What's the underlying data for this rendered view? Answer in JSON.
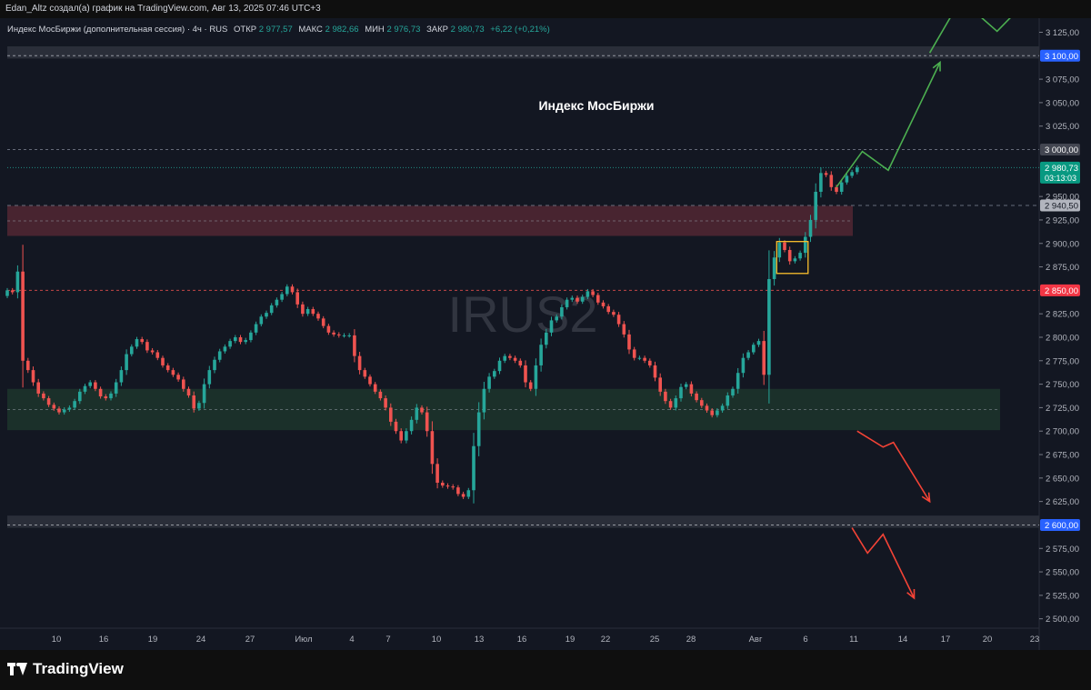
{
  "header": {
    "credit": "Edan_Altz создал(а) график на TradingView.com, Авг 13, 2025 07:46 UTC+3"
  },
  "legend": {
    "symbol": "Индекс МосБиржи (дополнительная сессия) · 4ч · RUS",
    "open_label": "ОТКР",
    "open_value": "2 977,57",
    "high_label": "МАКС",
    "high_value": "2 982,66",
    "low_label": "МИН",
    "low_value": "2 976,73",
    "close_label": "ЗАКР",
    "close_value": "2 980,73",
    "change": "+6,22 (+0,21%)"
  },
  "annotation_title": "Индекс МосБиржи",
  "watermark": "IRUS2",
  "brand": "TradingView",
  "colors": {
    "background": "#131722",
    "up": "#26a69a",
    "down": "#ef5350",
    "resistance_zone": "#5b2a35",
    "support_zone": "#1f3a2e",
    "level_band": "#2a2e39",
    "blue_label": "#2962ff",
    "red_label": "#f23645",
    "teal_label": "#089981",
    "arrow_up": "#4caf50",
    "arrow_down": "#f44336",
    "highlight_box": "#fbc02d"
  },
  "chart_data": {
    "type": "candlestick",
    "timeframe": "4ч",
    "y_range": [
      2490,
      3140
    ],
    "y_ticks": [
      "3 125,00",
      "3 075,00",
      "3 050,00",
      "3 025,00",
      "2 950,00",
      "2 925,00",
      "2 900,00",
      "2 875,00",
      "2 825,00",
      "2 800,00",
      "2 775,00",
      "2 750,00",
      "2 725,00",
      "2 700,00",
      "2 675,00",
      "2 650,00",
      "2 625,00",
      "2 575,00",
      "2 550,00",
      "2 525,00",
      "2 500,00"
    ],
    "y_tick_values": [
      3125,
      3075,
      3050,
      3025,
      2950,
      2925,
      2900,
      2875,
      2825,
      2800,
      2775,
      2750,
      2725,
      2700,
      2675,
      2650,
      2625,
      2575,
      2550,
      2525,
      2500
    ],
    "x_labels": [
      "10",
      "16",
      "19",
      "24",
      "27",
      "Июл",
      "4",
      "7",
      "10",
      "13",
      "16",
      "19",
      "22",
      "25",
      "28",
      "Авг",
      "6",
      "11",
      "14",
      "17",
      "20",
      "23"
    ],
    "price_labels": [
      {
        "value": 3100,
        "text": "3 100,00",
        "style": "blue"
      },
      {
        "value": 3000,
        "text": "3 000,00",
        "style": "gray"
      },
      {
        "value": 2980.73,
        "text": "2 980,73",
        "sub": "03:13:03",
        "style": "teal"
      },
      {
        "value": 2940.5,
        "text": "2 940,50",
        "style": "light"
      },
      {
        "value": 2850,
        "text": "2 850,00",
        "style": "red"
      },
      {
        "value": 2600,
        "text": "2 600,00",
        "style": "blue"
      }
    ],
    "zones": [
      {
        "name": "resistance",
        "from": 2908,
        "to": 2940
      },
      {
        "name": "support",
        "from": 2701,
        "to": 2745
      }
    ],
    "bands": [
      {
        "name": "band-3100",
        "from": 3097,
        "to": 3110
      },
      {
        "name": "band-2600",
        "from": 2597,
        "to": 2610
      }
    ],
    "closes": [
      2850,
      2848,
      2870,
      2775,
      2765,
      2752,
      2740,
      2735,
      2728,
      2724,
      2720,
      2723,
      2725,
      2732,
      2742,
      2748,
      2752,
      2745,
      2737,
      2735,
      2740,
      2752,
      2765,
      2782,
      2790,
      2798,
      2795,
      2786,
      2784,
      2778,
      2770,
      2765,
      2760,
      2755,
      2745,
      2738,
      2724,
      2730,
      2750,
      2765,
      2776,
      2785,
      2790,
      2796,
      2800,
      2795,
      2797,
      2805,
      2814,
      2822,
      2826,
      2834,
      2840,
      2846,
      2854,
      2848,
      2835,
      2825,
      2830,
      2825,
      2820,
      2812,
      2805,
      2803,
      2802,
      2802,
      2802,
      2780,
      2765,
      2758,
      2750,
      2742,
      2735,
      2725,
      2710,
      2700,
      2690,
      2700,
      2712,
      2725,
      2720,
      2700,
      2665,
      2645,
      2642,
      2641,
      2640,
      2633,
      2630,
      2637,
      2684,
      2720,
      2745,
      2758,
      2764,
      2775,
      2780,
      2778,
      2775,
      2770,
      2752,
      2745,
      2770,
      2792,
      2805,
      2818,
      2822,
      2832,
      2840,
      2842,
      2838,
      2843,
      2849,
      2845,
      2837,
      2833,
      2827,
      2824,
      2814,
      2803,
      2787,
      2778,
      2778,
      2775,
      2770,
      2757,
      2742,
      2732,
      2725,
      2735,
      2747,
      2750,
      2740,
      2733,
      2727,
      2722,
      2717,
      2722,
      2727,
      2738,
      2745,
      2762,
      2778,
      2784,
      2792,
      2796,
      2760,
      2862,
      2885,
      2901,
      2893,
      2881,
      2884,
      2890,
      2907,
      2925,
      2955,
      2975,
      2973,
      2960,
      2955,
      2965,
      2972,
      2976,
      2980.73
    ],
    "x_index_start_label": "10",
    "annotations": {
      "highlight_box": {
        "from_index": 149,
        "to_index": 154,
        "low": 2868,
        "high": 2902
      },
      "up_arrow_path": [
        [
          160,
          2960
        ],
        [
          165,
          2998
        ],
        [
          170,
          2978
        ],
        [
          180,
          3093
        ]
      ],
      "up_arrow_path_2": [
        [
          178,
          3103
        ],
        [
          184,
          3160
        ],
        [
          191,
          3126
        ],
        [
          197,
          3160
        ]
      ],
      "down_arrow_1": [
        [
          164,
          2700
        ],
        [
          169,
          2683
        ],
        [
          171,
          2688
        ],
        [
          178,
          2625
        ]
      ],
      "down_arrow_2": [
        [
          163,
          2597
        ],
        [
          166,
          2570
        ],
        [
          169,
          2590
        ],
        [
          175,
          2522
        ]
      ]
    }
  }
}
